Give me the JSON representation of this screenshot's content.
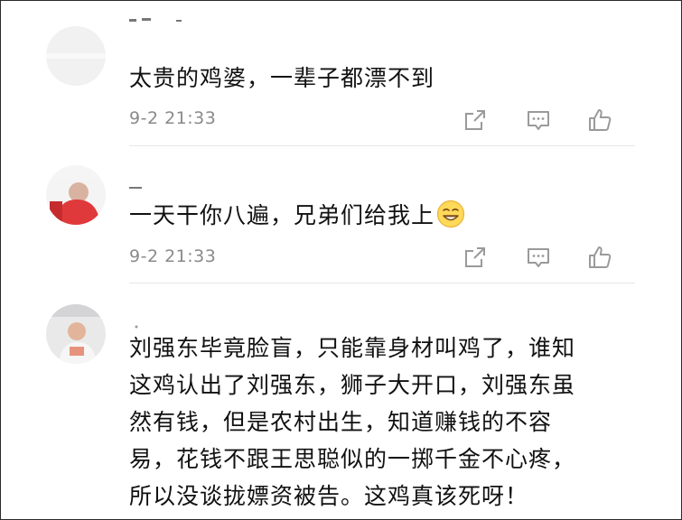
{
  "comments": [
    {
      "text": "太贵的鸡婆，一辈子都漂不到",
      "time": "9-2 21:33",
      "actions": [
        "share-icon",
        "reply-icon",
        "like-icon"
      ]
    },
    {
      "text": "一天干你八遍，兄弟们给我上",
      "emoji": "grinning-face-emoji",
      "time": "9-2 21:33",
      "actions": [
        "share-icon",
        "reply-icon",
        "like-icon"
      ]
    },
    {
      "text": "刘强东毕竟脸盲，只能靠身材叫鸡了，谁知\n这鸡认出了刘强东，狮子大开口，刘强东虽\n然有钱，但是农村出生，知道赚钱的不容\n易，花钱不跟王思聪似的一掷千金不心疼，\n所以没谈拢嫖资被告。这鸡真该死呀！"
    }
  ],
  "colors": {
    "text": "#111111",
    "meta": "#8a8a8a",
    "icon": "#9a9a9a",
    "divider": "#e6e6e6"
  }
}
